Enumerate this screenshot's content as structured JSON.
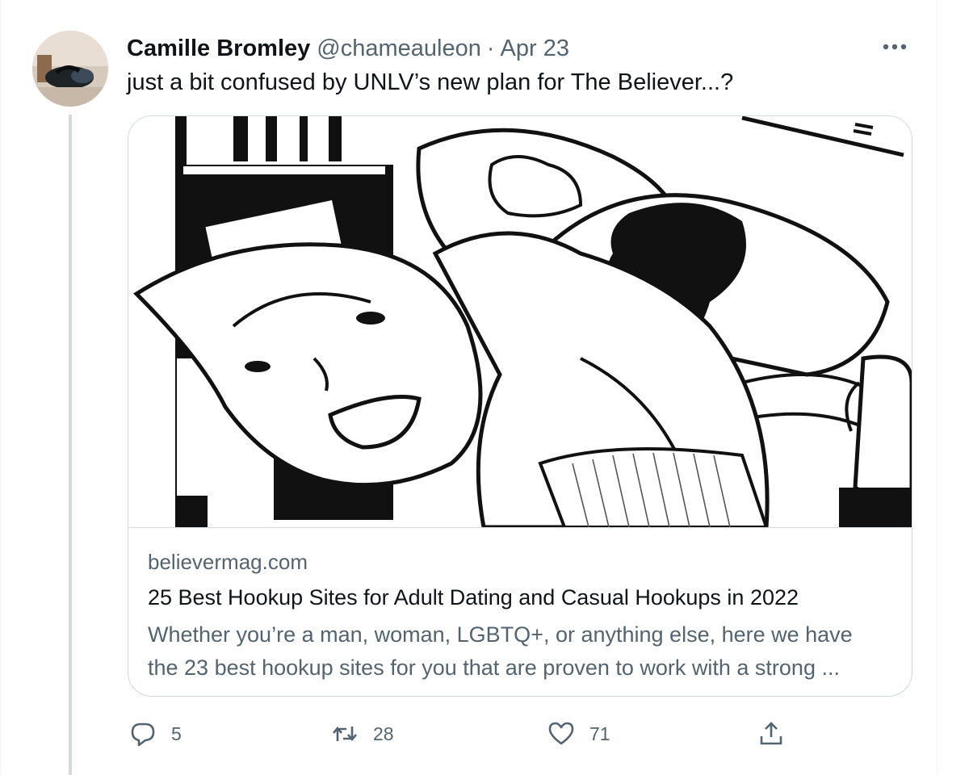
{
  "tweet": {
    "author_name": "Camille Bromley",
    "author_handle": "@chameauleon",
    "separator": "·",
    "date": "Apr 23",
    "text": "just a bit confused by UNLV’s new plan for The Believer...?",
    "more_icon": "more-horizontal-icon"
  },
  "card": {
    "domain": "believermag.com",
    "title": "25 Best Hookup Sites for Adult Dating and Casual Hookups in 2022",
    "description_lines": [
      "Whether you’re a man, woman, LGBTQ+, or anything else, here we have",
      "the 23 best hookup sites for you that are proven to work with a strong ..."
    ]
  },
  "actions": {
    "reply": {
      "icon": "reply-icon",
      "count": "5"
    },
    "retweet": {
      "icon": "retweet-icon",
      "count": "28"
    },
    "like": {
      "icon": "heart-icon",
      "count": "71"
    },
    "share": {
      "icon": "share-icon"
    }
  },
  "colors": {
    "text_primary": "#0f1419",
    "text_secondary": "#536471",
    "border": "#cfd9de"
  }
}
